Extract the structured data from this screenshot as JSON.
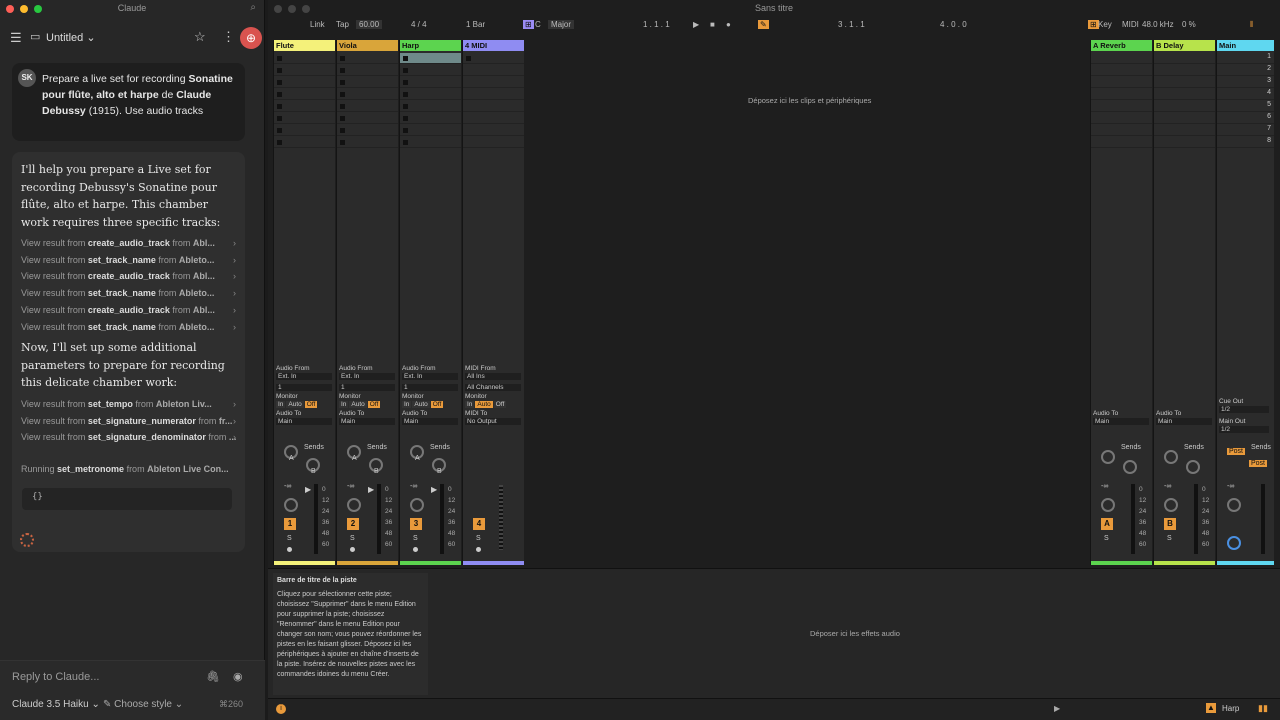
{
  "claude": {
    "window_title": "Claude",
    "chat_title": "Untitled",
    "user": {
      "initials": "SK",
      "message_pre": "Prepare a live set for recording ",
      "message_bold1": "Sonatine pour flûte, alto et harpe",
      "message_mid": " de ",
      "message_bold2": "Claude Debussy",
      "message_post": " (1915). Use audio tracks"
    },
    "assistant": {
      "para1": "I'll help you prepare a Live set for recording Debussy's Sonatine pour flûte, alto et harpe. This chamber work requires three specific tracks:",
      "para2": "Now, I'll set up some additional parameters to prepare for recording this delicate chamber work:",
      "view_prefix": "View result from ",
      "from_word": " from ",
      "tools1": [
        {
          "name": "create_audio_track",
          "src": "Abl..."
        },
        {
          "name": "set_track_name",
          "src": "Ableto..."
        },
        {
          "name": "create_audio_track",
          "src": "Abl..."
        },
        {
          "name": "set_track_name",
          "src": "Ableto..."
        },
        {
          "name": "create_audio_track",
          "src": "Abl..."
        },
        {
          "name": "set_track_name",
          "src": "Ableto..."
        }
      ],
      "tools2": [
        {
          "name": "set_tempo",
          "src": "Ableton Liv..."
        },
        {
          "name": "set_signature_numerator",
          "src": "fr..."
        },
        {
          "name": "set_signature_denominator",
          "src": "..."
        }
      ],
      "running_prefix": "Running ",
      "running_tool": "set_metronome",
      "running_src": "Ableton Live Con...",
      "code": "{}"
    },
    "reply_placeholder": "Reply to Claude...",
    "model": "Claude 3.5 Haiku",
    "style_label": "Choose style",
    "tokens": "260"
  },
  "ableton": {
    "title": "Sans titre",
    "control": {
      "link": "Link",
      "tap": "Tap",
      "tempo": "60.00",
      "signature": "4 / 4",
      "quantize": "1 Bar",
      "key": "C",
      "scale": "Major",
      "position": "1 .   1 .   1",
      "loop_start": "3 .   1 .   1",
      "loop_len": "4 .   0 .   0",
      "key_label": "Key",
      "midi_label": "MIDI",
      "sample_rate": "48.0 kHz",
      "cpu": "0 %"
    },
    "tracks": [
      {
        "name": "Flute",
        "color": "#f4f17a",
        "number": "1",
        "io_from": "Audio From",
        "in_src": "Ext. In",
        "in_ch": "1"
      },
      {
        "name": "Viola",
        "color": "#d9a53a",
        "number": "2",
        "io_from": "Audio From",
        "in_src": "Ext. In",
        "in_ch": "1"
      },
      {
        "name": "Harp",
        "color": "#5cd44f",
        "number": "3",
        "io_from": "Audio From",
        "in_src": "Ext. In",
        "in_ch": "1"
      },
      {
        "name": "4 MIDI",
        "color": "#8f8cf2",
        "number": "4",
        "io_from": "MIDI From",
        "in_src": "All Ins",
        "in_ch": "All Channels"
      }
    ],
    "monitor_label": "Monitor",
    "monitor_opts": [
      "In",
      "Auto",
      "Off"
    ],
    "audio_to": "Audio To",
    "midi_to": "MIDI To",
    "main": "Main",
    "no_output": "No Output",
    "sends": "Sends",
    "send_a": "A",
    "send_b": "B",
    "solo": "S",
    "fader_inf": "-∞",
    "fader_zero": "0",
    "db_scale": [
      "0",
      "12",
      "24",
      "36",
      "48",
      "60"
    ],
    "returns": [
      {
        "name": "A Reverb",
        "color": "#5cd44f",
        "letter": "A"
      },
      {
        "name": "B Delay",
        "color": "#b7e34b",
        "letter": "B"
      }
    ],
    "master": {
      "name": "Main",
      "color": "#5fd7f0",
      "cue_out": "Cue Out",
      "cue_val": "1/2",
      "main_out": "Main Out",
      "main_val": "1/2",
      "post": "Post"
    },
    "scenes": [
      "1",
      "2",
      "3",
      "4",
      "5",
      "6",
      "7",
      "8"
    ],
    "drop_clips": "Déposez ici les clips et périphériques",
    "drop_fx": "Déposer ici les effets audio",
    "info_title": "Barre de titre de la piste",
    "info_text": "Cliquez pour sélectionner cette piste; choisissez \"Supprimer\" dans le menu Edition pour supprimer la piste; choisissez \"Renommer\" dans le menu Edition pour changer son nom; vous pouvez réordonner les pistes en les faisant glisser. Déposez ici les périphériques à ajouter en chaîne d'inserts de la piste. Insérez de nouvelles pistes avec les commandes idoines du menu Créer.",
    "status_track": "Harp"
  }
}
